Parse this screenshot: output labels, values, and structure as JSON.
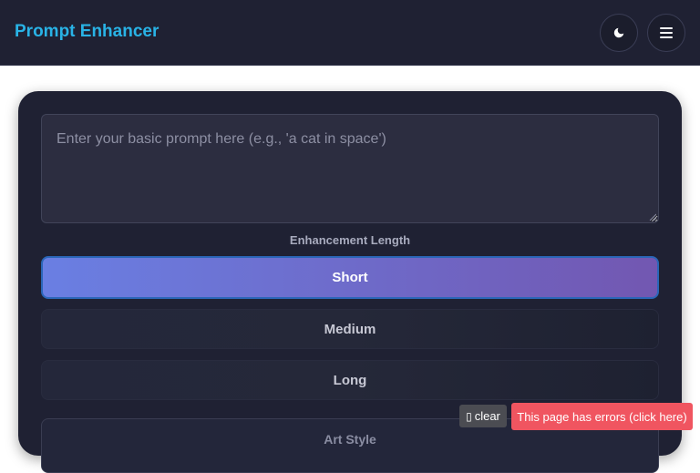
{
  "header": {
    "title": "Prompt Enhancer",
    "theme_icon": "moon-icon",
    "menu_icon": "hamburger-menu-icon"
  },
  "prompt": {
    "value": "",
    "placeholder": "Enter your basic prompt here (e.g., 'a cat in space')"
  },
  "enhancement": {
    "label": "Enhancement Length",
    "options": [
      "Short",
      "Medium",
      "Long"
    ],
    "selected": "Short"
  },
  "art_style": {
    "label": "Art Style"
  },
  "overlay": {
    "clear_label": "clear",
    "clear_icon": "missing-glyph-icon",
    "error_label": "This page has errors (click here)"
  },
  "colors": {
    "brand": "#29b3e6",
    "header_bg": "#1f2133",
    "active_gradient_start": "#6a7fe3",
    "active_gradient_end": "#7257b1",
    "error": "#f05560"
  }
}
